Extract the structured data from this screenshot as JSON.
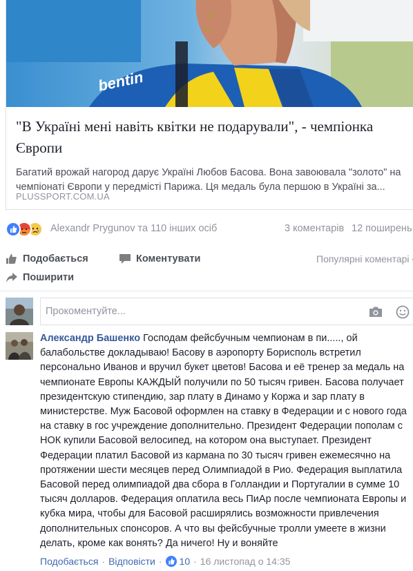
{
  "card": {
    "title": "\"В Україні мені навіть квітки не подарували\", - чемпіонка Європи",
    "description": "Багатий врожай нагород дарує Україні Любов Басова. Вона завоювала \"золото\" на чемпіонаті Європи у передмісті Парижа. Ця медаль була першою в Україні за...",
    "source": "PLUSSPORT.COM.UA",
    "image_icon": "cyclist-photo"
  },
  "summary": {
    "names": "Alexandr Prygunov та 110 інших осіб",
    "comments": "3 коментарів",
    "shares": "12 поширень",
    "reaction_icons": [
      "like-icon",
      "angry-icon",
      "sad-icon"
    ]
  },
  "actions": {
    "like": "Подобається",
    "comment": "Коментувати",
    "share": "Поширити",
    "popular": "Популярні коментарі"
  },
  "composer": {
    "placeholder": "Прокоментуйте..."
  },
  "comment": {
    "author": "Александр Башенко",
    "text": "Господам фейсбучным чемпионам в пи....., ой балабольстве докладываю! Басову в аэропорту Борисполь встретил персонально Иванов и вручил букет цветов! Басова и её тренер за медаль на чемпионате Европы КАЖДЫЙ получили по 50 тысяч гривен. Басова получает президентскую стипендию, зар плату в Динамо у Коржа и зар плату в министерстве. Муж Басовой оформлен на ставку в Федерации и с нового года на ставку в гос учреждение дополнительно. Президент Федерации пополам с НОК купили Басовой велосипед, на котором она выступает. Президент Федерации платил Басовой из кармана по 30 тысяч гривен ежемесячно на протяжении шести месяцев перед Олимпиадой в Рио. Федерация выплатила Басовой перед олимпиадой два сбора в Голландии и Португалии в сумме 10 тысяч долларов. Федерация оплатила весь ПиАр после чемпионата Европы и кубка мира, чтобы для Басовой расширялись возможности привлечения дополнительных спонсоров. А что вы фейсбучные тролли умеете в жизни делать, кроме как вонять? Да ничего! Ну и воняйте",
    "like_label": "Подобається",
    "reply_label": "Відповісти",
    "likes": "10",
    "timestamp": "16 листопад о 14:35",
    "separator": "·"
  },
  "colors": {
    "link_blue": "#365899",
    "like_blue": "#4080ff",
    "muted": "#90949c",
    "jersey_blue": "#1d5fb5",
    "jersey_yellow": "#f2d21b"
  }
}
